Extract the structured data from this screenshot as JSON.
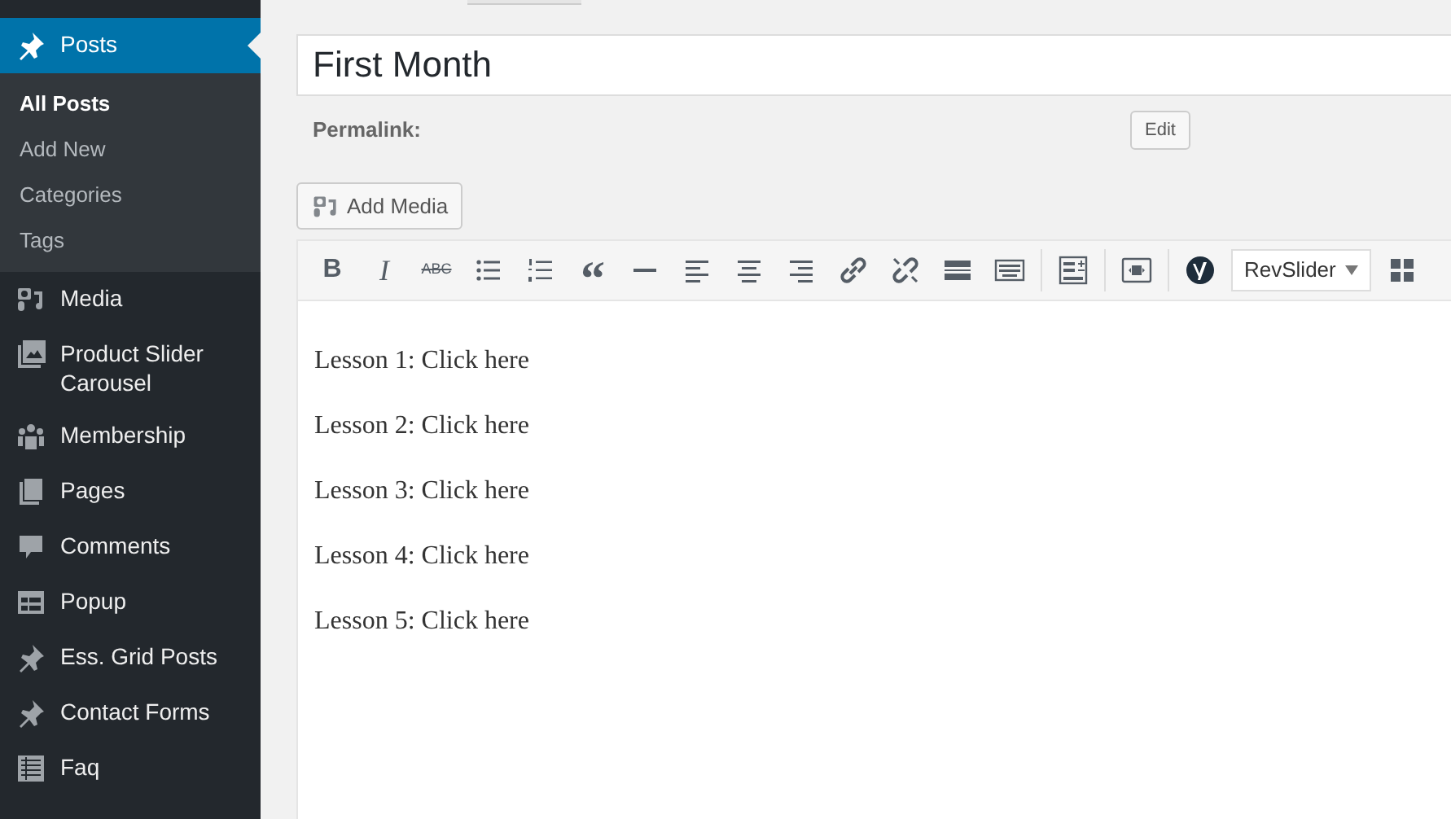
{
  "sidebar": {
    "items": [
      {
        "label": "Posts",
        "kind": "pin",
        "selected": true,
        "submenu": [
          {
            "label": "All Posts",
            "selected": true
          },
          {
            "label": "Add New",
            "selected": false
          },
          {
            "label": "Categories",
            "selected": false
          },
          {
            "label": "Tags",
            "selected": false
          }
        ]
      },
      {
        "label": "Media",
        "kind": "media",
        "selected": false
      },
      {
        "label": "Product Slider Carousel",
        "kind": "gallery",
        "selected": false
      },
      {
        "label": "Membership",
        "kind": "group",
        "selected": false
      },
      {
        "label": "Pages",
        "kind": "pages",
        "selected": false
      },
      {
        "label": "Comments",
        "kind": "comment",
        "selected": false
      },
      {
        "label": "Popup",
        "kind": "popup",
        "selected": false
      },
      {
        "label": "Ess. Grid Posts",
        "kind": "pin",
        "selected": false
      },
      {
        "label": "Contact Forms",
        "kind": "pin",
        "selected": false
      },
      {
        "label": "Faq",
        "kind": "list",
        "selected": false
      }
    ]
  },
  "editor": {
    "title": "First Month",
    "permalink_label": "Permalink:",
    "edit_button": "Edit",
    "add_media": "Add Media",
    "toolbar": [
      {
        "kind": "bold",
        "text": "B"
      },
      {
        "kind": "italic",
        "text": "I"
      },
      {
        "kind": "strike",
        "text": "ABC"
      },
      {
        "kind": "bullets"
      },
      {
        "kind": "numbers"
      },
      {
        "kind": "quote",
        "text": "“"
      },
      {
        "kind": "hr"
      },
      {
        "kind": "align-left"
      },
      {
        "kind": "align-center"
      },
      {
        "kind": "align-right"
      },
      {
        "kind": "link"
      },
      {
        "kind": "unlink"
      },
      {
        "kind": "more"
      },
      {
        "kind": "keyboard"
      },
      {
        "kind": "separator"
      },
      {
        "kind": "form"
      },
      {
        "kind": "separator"
      },
      {
        "kind": "shortcode"
      },
      {
        "kind": "separator"
      },
      {
        "kind": "yoast"
      },
      {
        "kind": "dropdown",
        "text": "RevSlider"
      },
      {
        "kind": "grid"
      }
    ],
    "content": [
      "Lesson 1: Click here",
      "Lesson 2: Click here",
      "Lesson 3: Click here",
      "Lesson 4: Click here",
      "Lesson 5: Click here"
    ]
  }
}
